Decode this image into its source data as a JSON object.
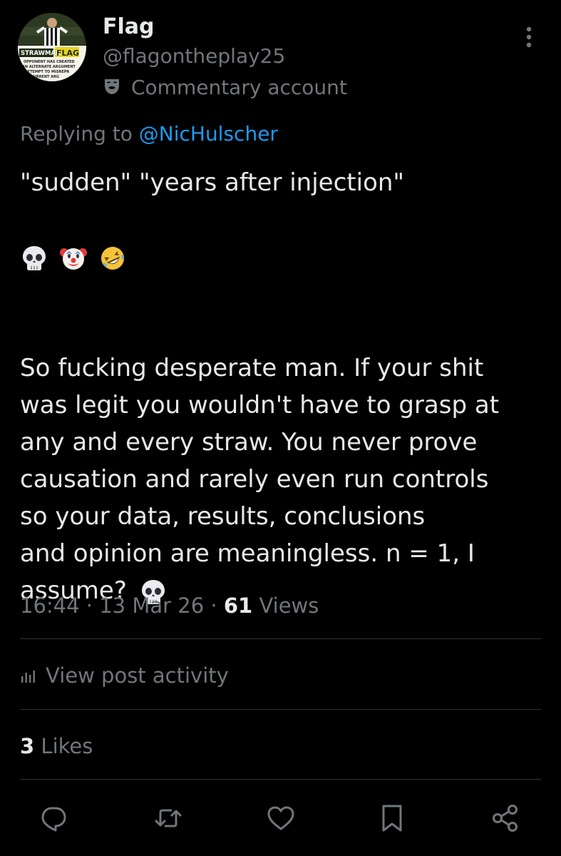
{
  "author": {
    "display_name": "Flag",
    "handle": "@flagontheplay25",
    "label_icon": "theater-mask-icon",
    "label": "Commentary account",
    "avatar_text": {
      "left_sign": "STRAWMAN",
      "flag_word": "FLAG",
      "lines": [
        "OPPONENT HAS CREATED",
        "AN ALTERNATE ARGUMENT",
        "ATTEMPT TO MISREPR",
        "CURRENT ARG"
      ]
    }
  },
  "reply": {
    "prefix": "Replying to ",
    "to_handle": "@NicHulscher"
  },
  "tweet": {
    "line1": "\"sudden\" \"years after injection\"",
    "emoji_line": [
      "skull-emoji",
      "clown-face-emoji",
      "rolling-laughing-emoji"
    ],
    "paragraph_lines": [
      "So fucking desperate man. If your shit",
      "was legit you wouldn't have to grasp at",
      "any and every straw. You never prove",
      "causation and rarely even run controls",
      "so your data, results, conclusions",
      "and opinion are meaningless. n = 1, I"
    ],
    "last_line_text": "assume?",
    "last_line_emoji": "skull-emoji"
  },
  "meta": {
    "time": "16:44",
    "separator": " · ",
    "date": "13 Mar 26",
    "views_count": "61",
    "views_label": "Views"
  },
  "activity": {
    "icon": "bar-chart-icon",
    "label": "View post activity"
  },
  "likes": {
    "count": "3",
    "label": "Likes"
  },
  "actions": [
    "reply-icon",
    "repost-icon",
    "like-icon",
    "bookmark-icon",
    "share-icon"
  ],
  "colors": {
    "background": "#000000",
    "primary_text": "#e7e9ea",
    "secondary_text": "#71767b",
    "link": "#1d9bf0",
    "divider": "#2f3336"
  }
}
